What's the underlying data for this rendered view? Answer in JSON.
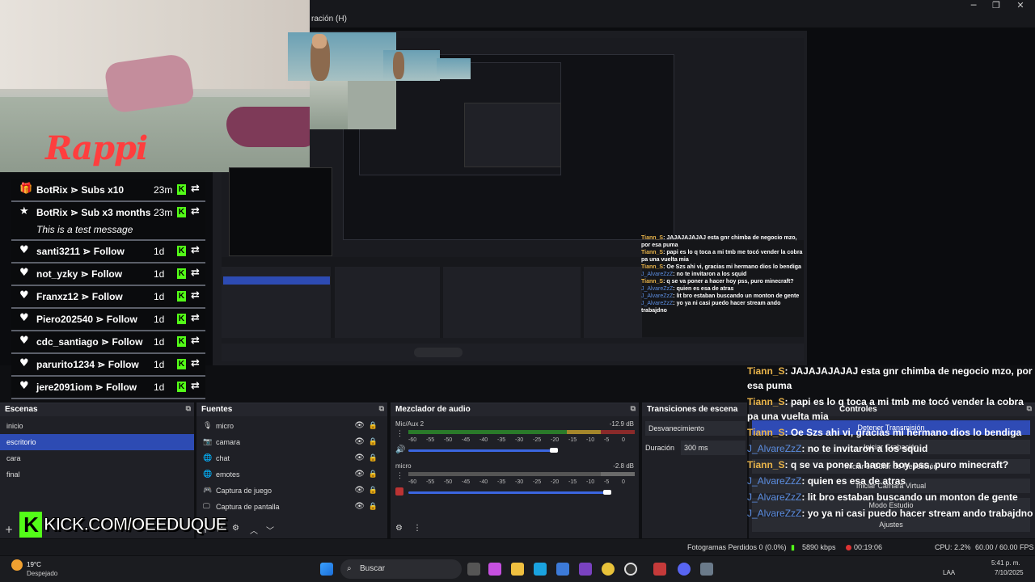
{
  "window": {
    "menu_visible": "ración (H)"
  },
  "webcam": {
    "brand": "Rappi"
  },
  "events": [
    {
      "icon": "gift-icon",
      "user": "BotRix",
      "action": "Subs x10",
      "time": "23m"
    },
    {
      "icon": "star-icon",
      "user": "BotRix",
      "action": "Sub x3 months",
      "time": "23m",
      "message": "This is a test message"
    },
    {
      "icon": "heart-icon",
      "user": "santi3211",
      "action": "Follow",
      "time": "1d"
    },
    {
      "icon": "heart-icon",
      "user": "not_yzky",
      "action": "Follow",
      "time": "1d"
    },
    {
      "icon": "heart-icon",
      "user": "Franxz12",
      "action": "Follow",
      "time": "1d"
    },
    {
      "icon": "heart-icon",
      "user": "Piero202540",
      "action": "Follow",
      "time": "1d"
    },
    {
      "icon": "heart-icon",
      "user": "cdc_santiago",
      "action": "Follow",
      "time": "1d"
    },
    {
      "icon": "heart-icon",
      "user": "parurito1234",
      "action": "Follow",
      "time": "1d"
    },
    {
      "icon": "heart-icon",
      "user": "jere2091iom",
      "action": "Follow",
      "time": "1d"
    }
  ],
  "chat": [
    {
      "user": "Tiann_S",
      "text": "JAJAJAJAJAJ esta gnr chimba de negocio mzo, por esa puma",
      "color": "gold"
    },
    {
      "user": "Tiann_S",
      "text": "papi es lo q toca a mi tmb me tocó vender la cobra pa una vuelta mia",
      "color": "gold"
    },
    {
      "user": "Tiann_S",
      "text": "Oe Szs ahi vi, gracias mi hermano dios lo bendiga",
      "color": "gold"
    },
    {
      "user": "J_AlvareZzZ",
      "text": "no te invitaron a los squid",
      "color": "blue"
    },
    {
      "user": "Tiann_S",
      "text": "q se va poner a hacer hoy pss, puro minecraft?",
      "color": "gold"
    },
    {
      "user": "J_AlvareZzZ",
      "text": "quien es esa de atras",
      "color": "blue"
    },
    {
      "user": "J_AlvareZzZ",
      "text": "lit bro estaban buscando un monton de gente",
      "color": "blue"
    },
    {
      "user": "J_AlvareZzZ",
      "text": "yo ya ni casi puedo hacer stream ando trabajdno",
      "color": "blue"
    }
  ],
  "scenes": {
    "title": "Escenas",
    "items": [
      "inicio",
      "escritorio",
      "cara",
      "final"
    ],
    "selected": "escritorio"
  },
  "sources": {
    "title": "Fuentes",
    "items": [
      {
        "label": "micro",
        "icon": "mic-icon"
      },
      {
        "label": "camara",
        "icon": "camera-icon"
      },
      {
        "label": "chat",
        "icon": "globe-icon"
      },
      {
        "label": "emotes",
        "icon": "globe-icon"
      },
      {
        "label": "Captura de juego",
        "icon": "gamepad-icon"
      },
      {
        "label": "Captura de pantalla",
        "icon": "monitor-icon"
      }
    ]
  },
  "mixer": {
    "title": "Mezclador de audio",
    "channels": [
      {
        "name": "Mic/Aux 2",
        "db": "-12.9 dB",
        "level": 0.9,
        "volume": 0.68
      },
      {
        "name": "micro",
        "db": "-2.8 dB",
        "level": 0.85,
        "volume": 0.93
      }
    ],
    "ticks": [
      "-60",
      "-55",
      "-50",
      "-45",
      "-40",
      "-35",
      "-30",
      "-25",
      "-20",
      "-15",
      "-10",
      "-5",
      "0"
    ]
  },
  "transitions": {
    "title": "Transiciones de escena",
    "type": "Desvanecimiento",
    "duration_label": "Duración",
    "duration": "300 ms"
  },
  "controls": {
    "title": "Controles",
    "buttons": [
      "Detener Transmisión",
      "Iniciar Grabación",
      "Iniciar el Búfer de Repetición",
      "Iniciar Cámara Virtual",
      "Modo Estudio",
      "Ajustes"
    ]
  },
  "kick_logo": "KICK.COM/OEEDUQUE",
  "status": {
    "dropped": "Fotogramas Perdidos 0 (0.0%)",
    "bitrate": "5890 kbps",
    "time": "00:19:06",
    "cpu": "CPU: 2.2%",
    "fps": "60.00 / 60.00 FPS"
  },
  "taskbar": {
    "weather_temp": "19°C",
    "weather_desc": "Despejado",
    "search": "Buscar",
    "lang": "LAA",
    "clock_time": "5:41 p. m.",
    "clock_date": "7/10/2025"
  },
  "colors": {
    "accent": "#2d4bb3",
    "kick_green": "#53fc18"
  }
}
